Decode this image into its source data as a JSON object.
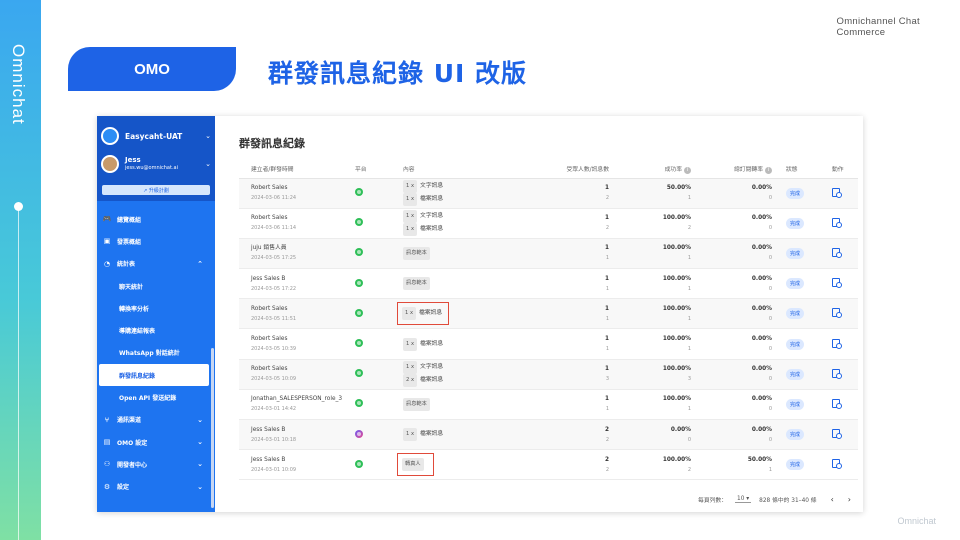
{
  "brand": {
    "vertical_logo": "Omnichat",
    "top_right": [
      "Omnichannel Chat",
      "Commerce"
    ],
    "bottom_right": "Omnichat"
  },
  "header": {
    "pill": "OMO",
    "title": "群發訊息紀錄 UI 改版"
  },
  "colors": {
    "primary": "#1e63e6",
    "sidebar": "#1e74f0",
    "highlight": "#e04a3a"
  },
  "sidebar": {
    "account_name": "Easycaht-UAT",
    "user_name": "Jess",
    "user_email": "jess.wu@omnichat.ai",
    "upgrade_label": "↗ 升級計劃",
    "items": [
      {
        "label": "總覽概組",
        "icon": "gamepad-icon",
        "chevron": ""
      },
      {
        "label": "發票概組",
        "icon": "receipt-icon",
        "chevron": ""
      },
      {
        "label": "統計表",
        "icon": "pie-chart-icon",
        "chevron": "⌃"
      },
      {
        "label": "聊天統計",
        "sub": true
      },
      {
        "label": "轉換率分析",
        "sub": true
      },
      {
        "label": "導購連結報表",
        "sub": true
      },
      {
        "label": "WhatsApp 對話統計",
        "sub": true
      },
      {
        "label": "群發訊息紀錄",
        "sub": true,
        "active": true
      },
      {
        "label": "Open API 發送紀錄",
        "sub": true
      },
      {
        "label": "通訊渠道",
        "icon": "network-icon",
        "chevron": "⌄"
      },
      {
        "label": "OMO 設定",
        "icon": "omo-icon",
        "chevron": "⌄"
      },
      {
        "label": "開發者中心",
        "icon": "developer-icon",
        "chevron": "⌄"
      },
      {
        "label": "設定",
        "icon": "gear-icon",
        "chevron": "⌄"
      }
    ]
  },
  "main": {
    "title": "群發訊息紀錄",
    "columns": {
      "creator": "建立者/群發時間",
      "platform": "平台",
      "content": "內容",
      "count": "受眾人數/訊息數",
      "rate": "成功率",
      "open": "總訂閱轉率",
      "status": "狀態",
      "action": "動作"
    },
    "rows": [
      {
        "creator": "Robert Sales",
        "time": "2024-03-06 11:24",
        "platform": "line",
        "content": [
          [
            "1 x",
            "文字訊息"
          ],
          [
            "1 x",
            "檔案訊息"
          ]
        ],
        "highlight": false,
        "count": "1",
        "msgs": "2",
        "rate": "50.00%",
        "rate_n": "1",
        "open": "0.00%",
        "open_n": "0",
        "status": "完成"
      },
      {
        "creator": "Robert Sales",
        "time": "2024-03-06 11:14",
        "platform": "line",
        "content": [
          [
            "1 x",
            "文字訊息"
          ],
          [
            "1 x",
            "檔案訊息"
          ]
        ],
        "highlight": false,
        "count": "1",
        "msgs": "2",
        "rate": "100.00%",
        "rate_n": "2",
        "open": "0.00%",
        "open_n": "0",
        "status": "完成"
      },
      {
        "creator": "juju 銷售人員",
        "time": "2024-03-05 17:25",
        "platform": "line",
        "content": [
          [
            "訊息範本",
            ""
          ]
        ],
        "highlight": false,
        "count": "1",
        "msgs": "1",
        "rate": "100.00%",
        "rate_n": "1",
        "open": "0.00%",
        "open_n": "0",
        "status": "完成"
      },
      {
        "creator": "Jess Sales B",
        "time": "2024-03-05 17:22",
        "platform": "line",
        "content": [
          [
            "訊息範本",
            ""
          ]
        ],
        "highlight": false,
        "count": "1",
        "msgs": "1",
        "rate": "100.00%",
        "rate_n": "1",
        "open": "0.00%",
        "open_n": "0",
        "status": "完成"
      },
      {
        "creator": "Robert Sales",
        "time": "2024-03-05 11:51",
        "platform": "line",
        "content": [
          [
            "1 x",
            "檔案訊息"
          ]
        ],
        "highlight": true,
        "count": "1",
        "msgs": "1",
        "rate": "100.00%",
        "rate_n": "1",
        "open": "0.00%",
        "open_n": "0",
        "status": "完成"
      },
      {
        "creator": "Robert Sales",
        "time": "2024-03-05 10:39",
        "platform": "line",
        "content": [
          [
            "1 x",
            "檔案訊息"
          ]
        ],
        "highlight": false,
        "count": "1",
        "msgs": "1",
        "rate": "100.00%",
        "rate_n": "1",
        "open": "0.00%",
        "open_n": "0",
        "status": "完成"
      },
      {
        "creator": "Robert Sales",
        "time": "2024-03-05 10:09",
        "platform": "line",
        "content": [
          [
            "1 x",
            "文字訊息"
          ],
          [
            "2 x",
            "檔案訊息"
          ]
        ],
        "highlight": false,
        "count": "1",
        "msgs": "3",
        "rate": "100.00%",
        "rate_n": "3",
        "open": "0.00%",
        "open_n": "0",
        "status": "完成"
      },
      {
        "creator": "Jonathan_SALESPERSON_role_3",
        "time": "2024-03-01 14:42",
        "platform": "line",
        "content": [
          [
            "訊息範本",
            ""
          ]
        ],
        "highlight": false,
        "count": "1",
        "msgs": "1",
        "rate": "100.00%",
        "rate_n": "1",
        "open": "0.00%",
        "open_n": "0",
        "status": "完成"
      },
      {
        "creator": "Jess Sales B",
        "time": "2024-03-01 10:18",
        "platform": "messenger",
        "content": [
          [
            "1 x",
            "檔案訊息"
          ]
        ],
        "highlight": false,
        "count": "2",
        "msgs": "2",
        "rate": "0.00%",
        "rate_n": "0",
        "open": "0.00%",
        "open_n": "0",
        "status": "完成"
      },
      {
        "creator": "Jess Sales B",
        "time": "2024-03-01 10:09",
        "platform": "line",
        "content": [
          [
            "轉真人",
            ""
          ]
        ],
        "highlight": true,
        "count": "2",
        "msgs": "2",
        "rate": "100.00%",
        "rate_n": "2",
        "open": "50.00%",
        "open_n": "1",
        "status": "完成"
      }
    ],
    "pager": {
      "per_page_label": "每頁列數：",
      "per_page": "10 ▾",
      "range": "828 條中的 31–40 條",
      "prev": "‹",
      "next": "›"
    }
  }
}
